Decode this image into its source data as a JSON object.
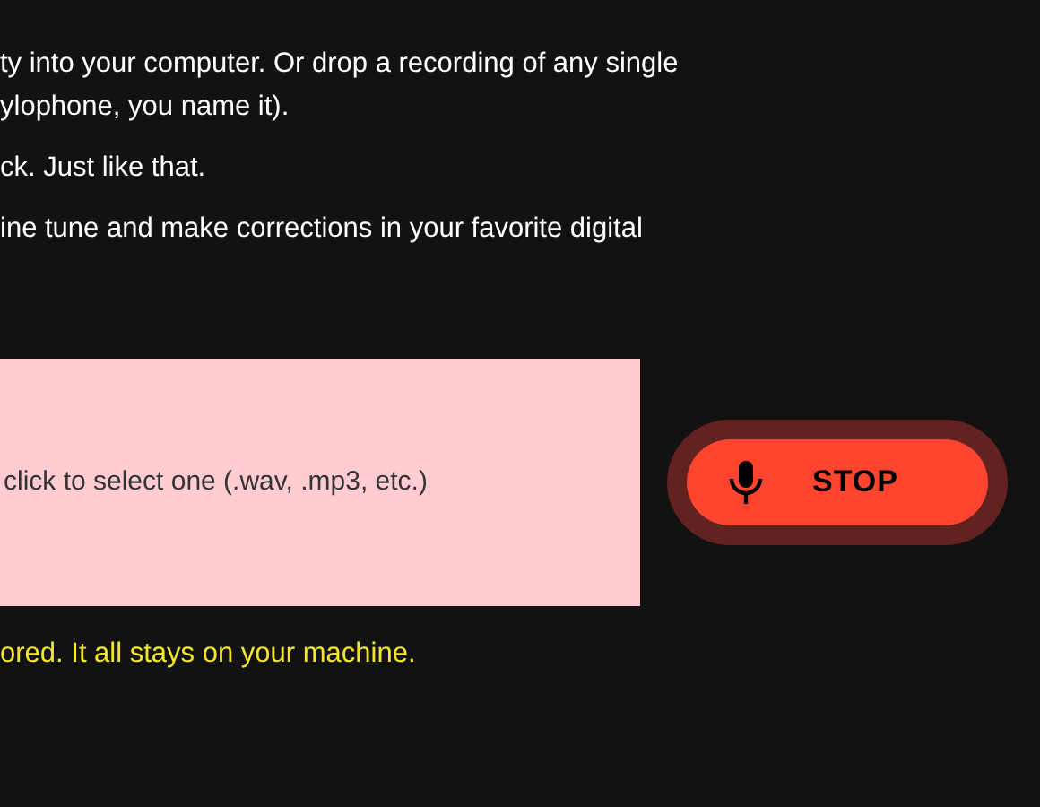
{
  "intro": {
    "lines": [
      "ty into your computer. Or drop a recording of any single",
      "ylophone, you name it)."
    ]
  },
  "paragraphs": [
    "ck. Just like that.",
    "ine tune and make corrections in your favorite digital"
  ],
  "drop_zone": {
    "text": "click to select one (.wav, .mp3, etc.)"
  },
  "record_button": {
    "label": "STOP",
    "recording": true
  },
  "privacy_note": "ored. It all stays on your machine."
}
